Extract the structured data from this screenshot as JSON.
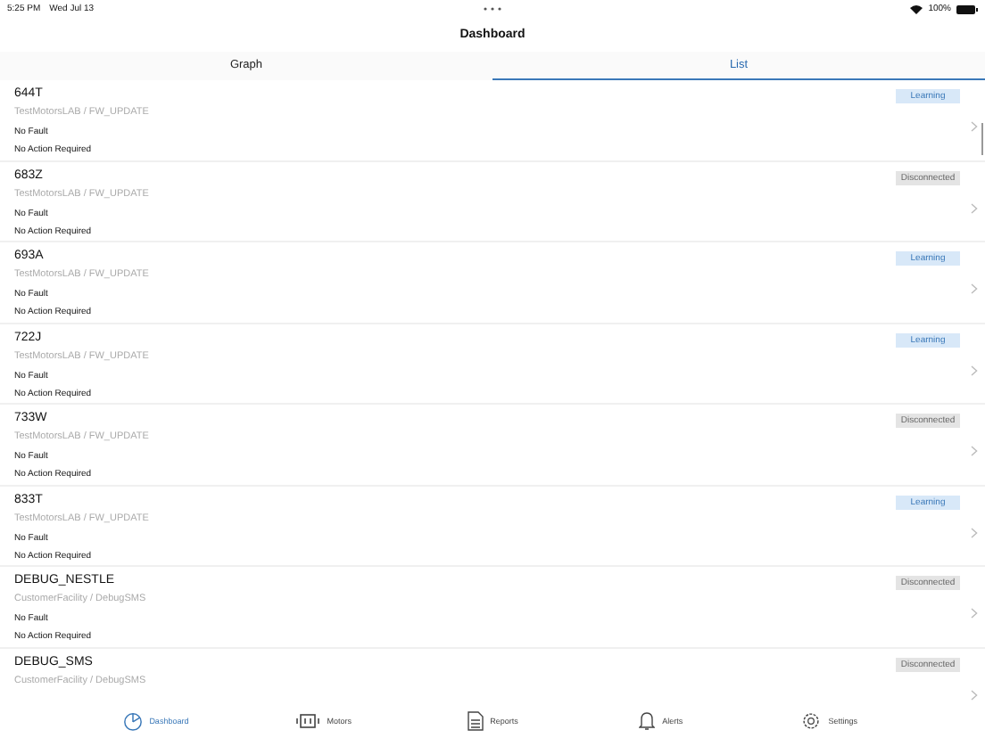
{
  "status_bar": {
    "time": "5:25 PM",
    "date": "Wed Jul 13",
    "battery": "100%"
  },
  "nav_title": "Dashboard",
  "tabs": [
    {
      "label": "Graph",
      "selected": false
    },
    {
      "label": "List",
      "selected": true
    }
  ],
  "rows": [
    {
      "name": "644T",
      "location": "TestMotorsLAB / FW_UPDATE",
      "fault": "No Fault",
      "action": "No Action Required",
      "status": "Learning",
      "kind": "learning"
    },
    {
      "name": "683Z",
      "location": "TestMotorsLAB / FW_UPDATE",
      "fault": "No Fault",
      "action": "No Action Required",
      "status": "Disconnected",
      "kind": "disconnected"
    },
    {
      "name": "693A",
      "location": "TestMotorsLAB / FW_UPDATE",
      "fault": "No Fault",
      "action": "No Action Required",
      "status": "Learning",
      "kind": "learning"
    },
    {
      "name": "722J",
      "location": "TestMotorsLAB / FW_UPDATE",
      "fault": "No Fault",
      "action": "No Action Required",
      "status": "Learning",
      "kind": "learning"
    },
    {
      "name": "733W",
      "location": "TestMotorsLAB / FW_UPDATE",
      "fault": "No Fault",
      "action": "No Action Required",
      "status": "Disconnected",
      "kind": "disconnected"
    },
    {
      "name": "833T",
      "location": "TestMotorsLAB / FW_UPDATE",
      "fault": "No Fault",
      "action": "No Action Required",
      "status": "Learning",
      "kind": "learning"
    },
    {
      "name": "DEBUG_NESTLE",
      "location": "CustomerFacility / DebugSMS",
      "fault": "No Fault",
      "action": "No Action Required",
      "status": "Disconnected",
      "kind": "disconnected"
    },
    {
      "name": "DEBUG_SMS",
      "location": "CustomerFacility / DebugSMS",
      "status": "Disconnected",
      "kind": "disconnected"
    }
  ],
  "tab_bar": [
    {
      "label": "Dashboard",
      "kind": "dashboard",
      "selected": true
    },
    {
      "label": "Motors",
      "kind": "motors",
      "selected": false
    },
    {
      "label": "Reports",
      "kind": "reports",
      "selected": false
    },
    {
      "label": "Alerts",
      "kind": "alerts",
      "selected": false
    },
    {
      "label": "Settings",
      "kind": "settings",
      "selected": false
    }
  ]
}
